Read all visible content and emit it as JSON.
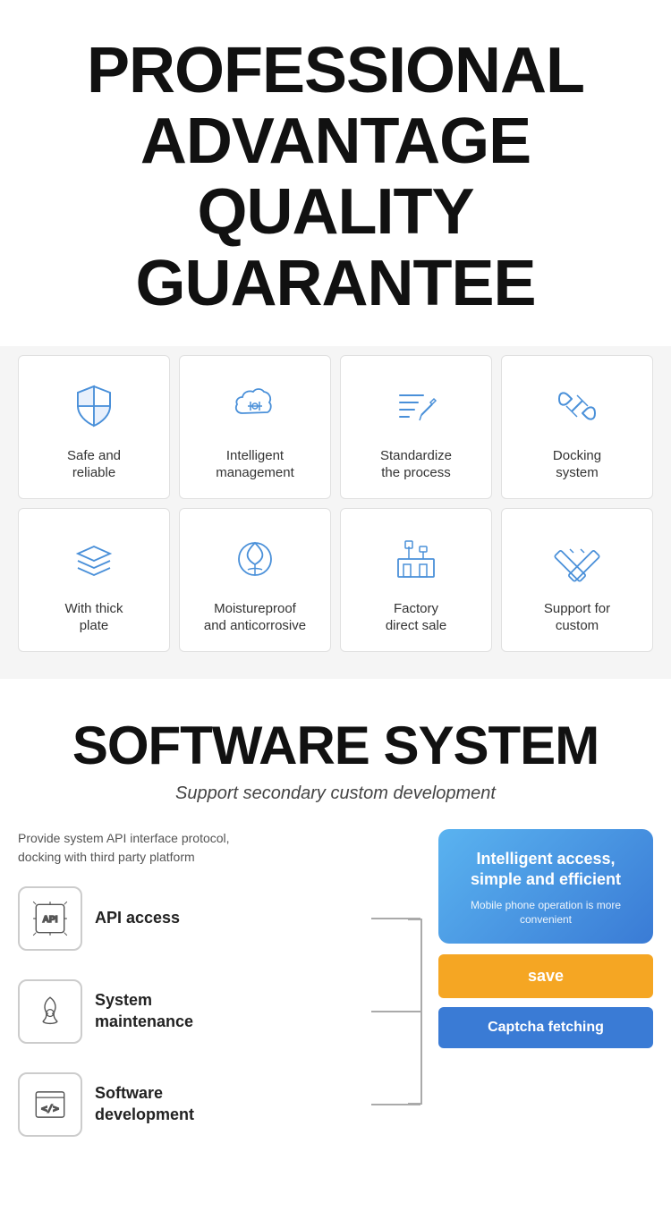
{
  "header": {
    "line1": "PROFESSIONAL",
    "line2": "ADVANTAGE",
    "line3": "QUALITY GUARANTEE"
  },
  "features": {
    "row1": [
      {
        "id": "safe-reliable",
        "label": "Safe and\nreliable",
        "icon": "shield"
      },
      {
        "id": "intelligent-management",
        "label": "Intelligent\nmanagement",
        "icon": "cloud-settings"
      },
      {
        "id": "standardize-process",
        "label": "Standardize\nthe process",
        "icon": "pencil-lines"
      },
      {
        "id": "docking-system",
        "label": "Docking\nsystem",
        "icon": "link"
      }
    ],
    "row2": [
      {
        "id": "thick-plate",
        "label": "With thick\nplate",
        "icon": "layers"
      },
      {
        "id": "moistureproof",
        "label": "Moistureproof\nand anticorrosive",
        "icon": "leaf-drop"
      },
      {
        "id": "factory-direct",
        "label": "Factory\ndirect sale",
        "icon": "factory"
      },
      {
        "id": "support-custom",
        "label": "Support for\ncustom",
        "icon": "pencil-ruler"
      }
    ]
  },
  "software": {
    "title": "SOFTWARE SYSTEM",
    "subtitle": "Support secondary custom development",
    "description": "Provide system API interface protocol,\ndocking with third party platform",
    "items": [
      {
        "id": "api-access",
        "label": "API access",
        "icon": "api"
      },
      {
        "id": "system-maintenance",
        "label": "System\nmaintenance",
        "icon": "drop-wrench"
      },
      {
        "id": "software-development",
        "label": "Software\ndevelopment",
        "icon": "code"
      }
    ],
    "panel": {
      "title": "Intelligent access,\nsimple and efficient",
      "subtitle": "Mobile phone operation is more\nconvenient",
      "save_btn": "save",
      "captcha_btn": "Captcha fetching"
    }
  }
}
